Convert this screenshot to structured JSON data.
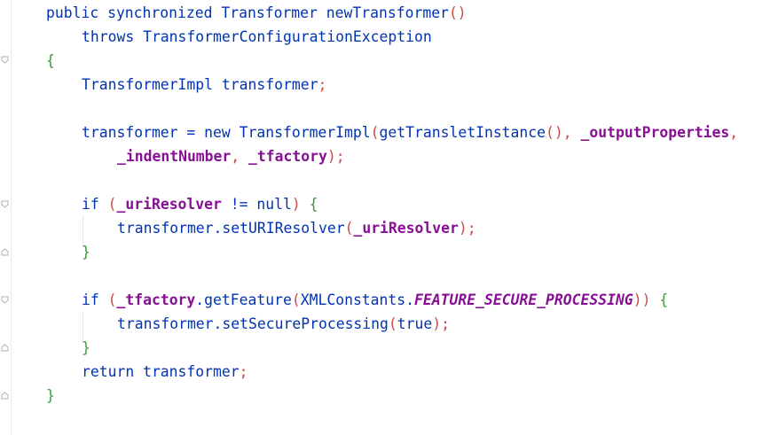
{
  "editor": {
    "lines": [
      {
        "tokens": [
          "public synchronized Transformer newTransformer",
          "()"
        ]
      },
      {
        "tokens": [
          "throws TransformerConfigurationException"
        ]
      },
      {
        "tokens": [
          "{"
        ]
      },
      {
        "tokens": [
          "TransformerImpl transformer",
          ";"
        ]
      },
      {
        "tokens": [
          "transformer = new TransformerImpl",
          "(",
          "getTransletInstance",
          "()",
          ", ",
          "_outputProperties",
          ","
        ]
      },
      {
        "tokens": [
          "_indentNumber",
          ", ",
          "_tfactory",
          ")",
          ";"
        ]
      },
      {
        "tokens": [
          "if ",
          "(",
          "_uriResolver",
          " != null",
          ")",
          " {"
        ]
      },
      {
        "tokens": [
          "transformer.setURIResolver",
          "(",
          "_uriResolver",
          ")",
          ";"
        ]
      },
      {
        "tokens": [
          "}"
        ]
      },
      {
        "tokens": [
          "if ",
          "(",
          "_tfactory",
          ".getFeature",
          "(",
          "XMLConstants.",
          "FEATURE_SECURE_PROCESSING",
          ")",
          ")",
          " {"
        ]
      },
      {
        "tokens": [
          "transformer.setSecureProcessing",
          "(",
          "true",
          ")",
          ";"
        ]
      },
      {
        "tokens": [
          "}"
        ]
      },
      {
        "tokens": [
          "return transformer",
          ";"
        ]
      },
      {
        "tokens": [
          "}"
        ]
      }
    ]
  },
  "colors": {
    "keyword": "#0033b3",
    "field": "#871094",
    "paren": "#c94b4b",
    "brace": "#3c9a3c",
    "text": "#080808"
  }
}
